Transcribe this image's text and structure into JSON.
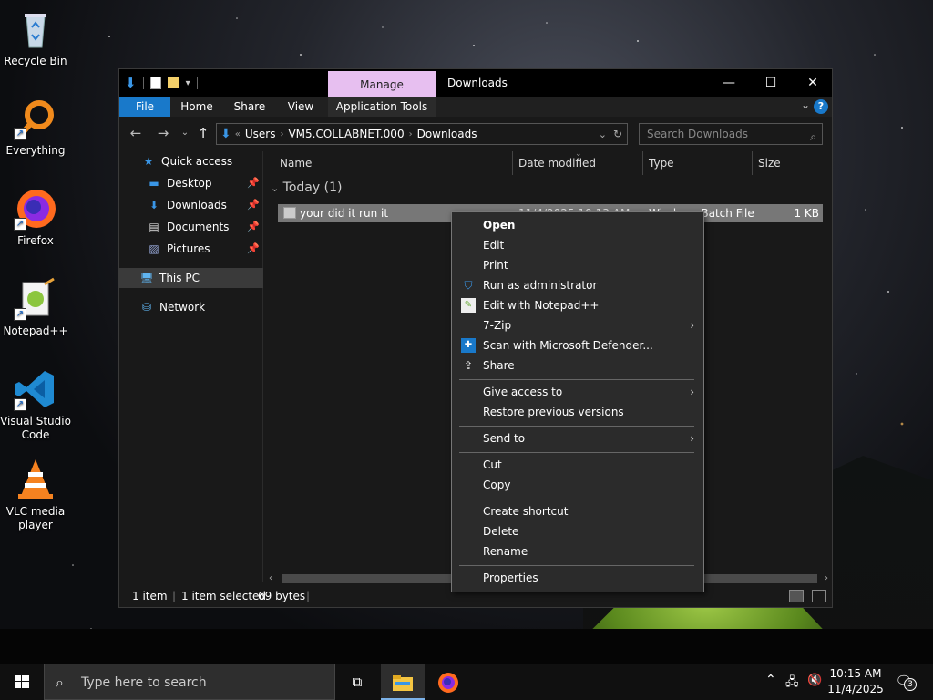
{
  "desktop": {
    "icons": [
      {
        "label": "Recycle Bin"
      },
      {
        "label": "Everything"
      },
      {
        "label": "Firefox"
      },
      {
        "label": "Notepad++"
      },
      {
        "label": "Visual Studio Code"
      },
      {
        "label": "VLC media player"
      }
    ]
  },
  "window": {
    "title": "Downloads",
    "manage_tab": "Manage",
    "ribbon_tabs": [
      "File",
      "Home",
      "Share",
      "View",
      "Application Tools"
    ],
    "address": [
      "Users",
      "VM5.COLLABNET.000",
      "Downloads"
    ],
    "search_placeholder": "Search Downloads",
    "nav": {
      "quick_access": "Quick access",
      "pinned": [
        "Desktop",
        "Downloads",
        "Documents",
        "Pictures"
      ],
      "this_pc": "This PC",
      "network": "Network"
    },
    "columns": [
      "Name",
      "Date modified",
      "Type",
      "Size"
    ],
    "group": "Today (1)",
    "file": {
      "name": "your did it run it",
      "date": "11/4/2025 10:13 AM",
      "type": "Windows Batch File",
      "size": "1 KB"
    },
    "status": {
      "items": "1 item",
      "selected": "1 item selected",
      "bytes": "69 bytes"
    }
  },
  "context_menu": {
    "items": [
      "Open",
      "Edit",
      "Print",
      "Run as administrator",
      "Edit with Notepad++",
      "7-Zip",
      "Scan with Microsoft Defender...",
      "Share",
      "Give access to",
      "Restore previous versions",
      "Send to",
      "Cut",
      "Copy",
      "Create shortcut",
      "Delete",
      "Rename",
      "Properties"
    ]
  },
  "taskbar": {
    "search_placeholder": "Type here to search",
    "time": "10:15 AM",
    "date": "11/4/2025",
    "notification_count": "3"
  },
  "colors": {
    "accent": "#1979ca",
    "manage_tab": "#e7bff0",
    "selection": "#777777"
  }
}
